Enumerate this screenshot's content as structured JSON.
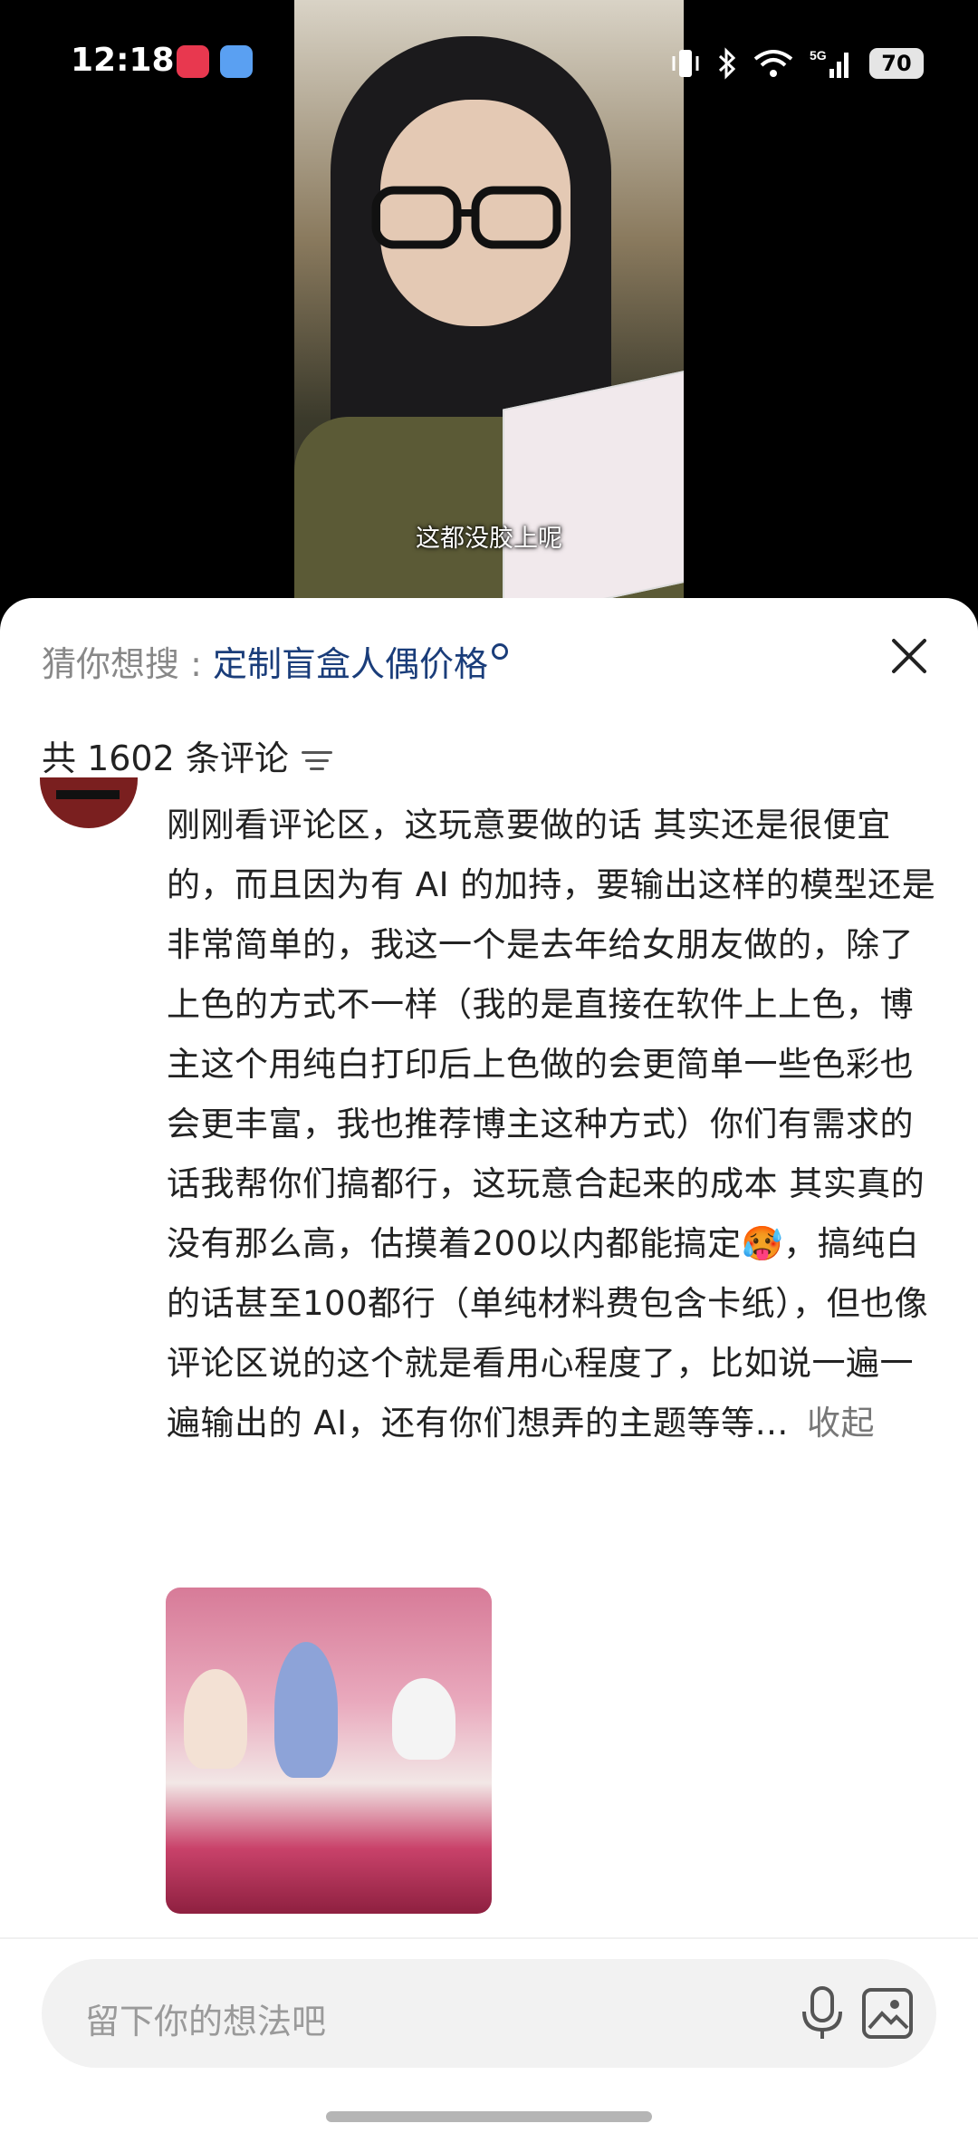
{
  "status_bar": {
    "time": "12:18",
    "battery": "70",
    "network": "5G"
  },
  "video": {
    "subtitle": "这都没胶上呢"
  },
  "sheet": {
    "suggest_label": "猜你想搜 : ",
    "suggest_term": "定制盲盒人偶价格",
    "comment_count": "共 1602 条评论",
    "comment": {
      "text": "刚刚看评论区，这玩意要做的话 其实还是很便宜的，而且因为有 AI 的加持，要输出这样的模型还是非常简单的，我这一个是去年给女朋友做的，除了上色的方式不一样（我的是直接在软件上上色，博主这个用纯白打印后上色做的会更简单一些色彩也会更丰富，我也推荐博主这种方式）你们有需求的话我帮你们搞都行，这玩意合起来的成本 其实真的没有那么高，估摸着200以内都能搞定🥵，搞纯白的话甚至100都行（单纯材料费包含卡纸），但也像评论区说的这个就是看用心程度了，比如说一遍一遍输出的 AI，还有你们想弄的主题等等…",
      "collapse": "收起"
    }
  },
  "input": {
    "placeholder": "留下你的想法吧"
  }
}
